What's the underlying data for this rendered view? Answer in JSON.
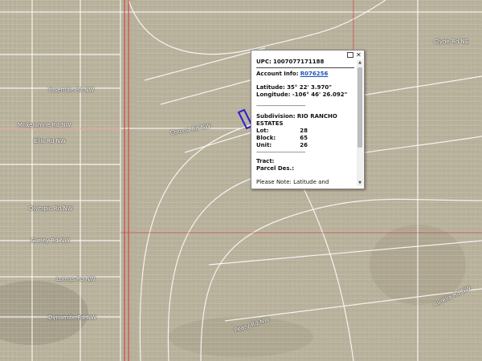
{
  "popup": {
    "upc_label": "UPC:",
    "upc_value": "1007077171188",
    "account_label": "Account Info:",
    "account_link": "R076256",
    "latitude_label": "Latitude:",
    "latitude_value": "35° 22' 3.970\"",
    "longitude_label": "Longitude:",
    "longitude_value": "-106° 46' 26.092\"",
    "separator": "------------------------------",
    "subdivision_label": "Subdivision:",
    "subdivision_value": "RIO RANCHO ESTATES",
    "lot_label": "Lot:",
    "lot_value": "28",
    "block_label": "Block:",
    "block_value": "65",
    "unit_label": "Unit:",
    "unit_value": "26",
    "tract_label": "Tract:",
    "parcel_label": "Parcel Des.:",
    "note": "Please Note: Latitude and Longitude is the approximate center of the parcel shown.",
    "minimize_icon": "minimize-icon",
    "close_icon": "close-icon",
    "close_glyph": "✕"
  },
  "map_labels": [
    "Clyde Rd NE",
    "Yosemite Rd NW",
    "Mokelumne Rd NW",
    "Corona Rd NW",
    "Ellis Rd NW",
    "Olympic Rd NW",
    "Gurley Rd NW",
    "Lomas Rd NW",
    "Dynamite Rd NW",
    "Aurelia Rd NW",
    "Peary Rd NW"
  ],
  "colors": {
    "terrain": "#b9b39d",
    "parcel_line": "#ffffff",
    "red_boundary": "#d8232a",
    "highlight": "#2a1fd6"
  }
}
